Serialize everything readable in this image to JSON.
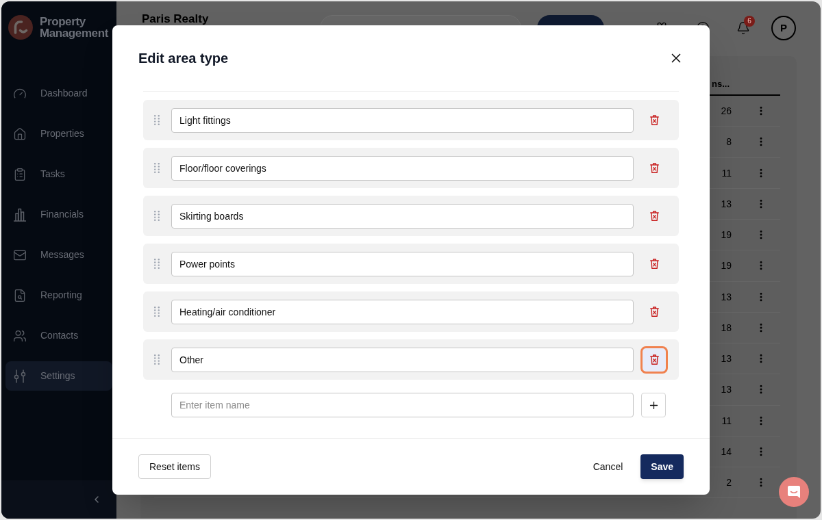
{
  "sidebar": {
    "logo_text": "Property Management",
    "items": [
      {
        "label": "Dashboard",
        "selected": false
      },
      {
        "label": "Properties",
        "selected": false
      },
      {
        "label": "Tasks",
        "selected": false
      },
      {
        "label": "Financials",
        "selected": false
      },
      {
        "label": "Messages",
        "selected": false
      },
      {
        "label": "Reporting",
        "selected": false
      },
      {
        "label": "Contacts",
        "selected": false
      },
      {
        "label": "Settings",
        "selected": true
      }
    ]
  },
  "header": {
    "title": "Paris Realty",
    "notification_count": "6",
    "avatar_initial": "P"
  },
  "table": {
    "column_header": "ns...",
    "rows": [
      {
        "count": "26"
      },
      {
        "count": "8"
      },
      {
        "count": "11"
      },
      {
        "count": "13"
      },
      {
        "count": "19"
      },
      {
        "count": "19"
      },
      {
        "count": "13"
      },
      {
        "count": "18"
      },
      {
        "count": "13"
      },
      {
        "count": "13"
      },
      {
        "count": "11"
      },
      {
        "count": "14"
      },
      {
        "count": "2"
      }
    ]
  },
  "dialog": {
    "title": "Edit area type",
    "items": [
      {
        "value": "Light fittings",
        "focused": false
      },
      {
        "value": "Floor/floor coverings",
        "focused": false
      },
      {
        "value": "Skirting boards",
        "focused": false
      },
      {
        "value": "Power points",
        "focused": false
      },
      {
        "value": "Heating/air conditioner",
        "focused": false
      },
      {
        "value": "Other",
        "focused": true
      }
    ],
    "new_item": {
      "placeholder": "Enter item name"
    },
    "buttons": {
      "reset": "Reset items",
      "cancel": "Cancel",
      "save": "Save"
    }
  }
}
